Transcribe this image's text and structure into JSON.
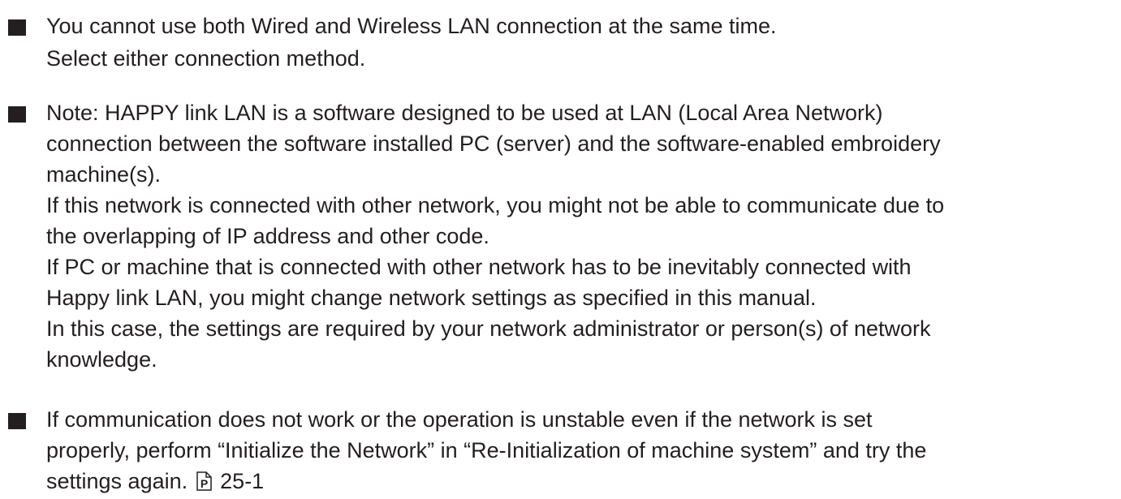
{
  "notes": [
    {
      "lines": [
        "You cannot use both Wired and Wireless LAN connection at the same time.",
        "Select either connection method."
      ]
    },
    {
      "lines": [
        "Note: HAPPY link LAN is a software designed to be used at LAN (Local Area Network)",
        "connection between the software installed PC (server) and the software-enabled embroidery",
        "machine(s).",
        "If this network is connected with other network, you might not be able to communicate due to",
        "the overlapping of IP address and other code.",
        "If PC or machine that is connected with other network has to be inevitably connected with",
        "Happy link LAN, you might change network settings as specified in this manual.",
        "In this case, the settings are required by your network administrator or person(s) of network",
        "knowledge."
      ]
    },
    {
      "lines": [
        "If communication does not work or the operation is unstable even if the network is set",
        "properly, perform “Initialize the Network” in “Re-Initialization of machine system” and try the"
      ],
      "last_line_text": "settings again.",
      "reference_icon": "page-reference-icon",
      "reference_page": "25-1"
    }
  ]
}
